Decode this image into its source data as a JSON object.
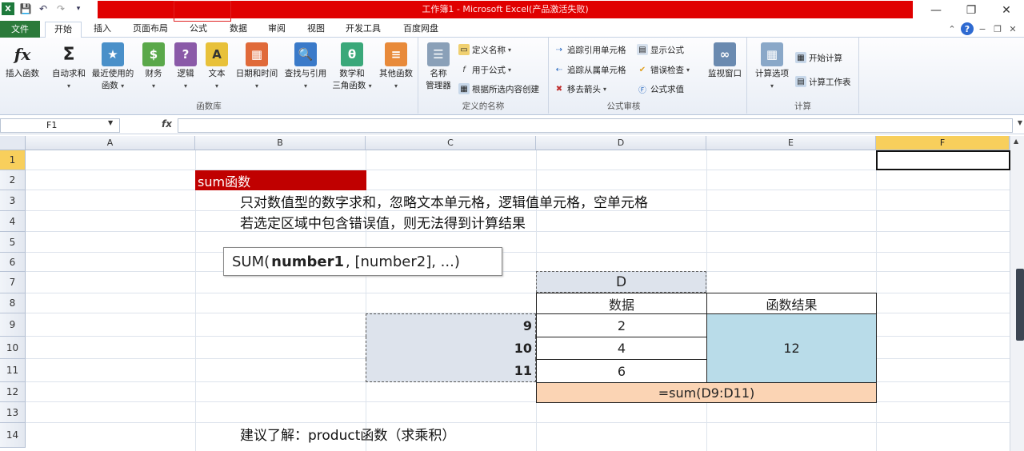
{
  "title_bar": {
    "title": "工作簿1 - Microsoft Excel(产品激活失败)"
  },
  "tabs": [
    {
      "label": "文件",
      "id": "file"
    },
    {
      "label": "开始",
      "id": "home"
    },
    {
      "label": "插入",
      "id": "insert"
    },
    {
      "label": "页面布局",
      "id": "page-layout"
    },
    {
      "label": "公式",
      "id": "formulas"
    },
    {
      "label": "数据",
      "id": "data"
    },
    {
      "label": "审阅",
      "id": "review"
    },
    {
      "label": "视图",
      "id": "view"
    },
    {
      "label": "开发工具",
      "id": "developer"
    },
    {
      "label": "百度网盘",
      "id": "baidu"
    }
  ],
  "ribbon": {
    "function_library": {
      "group_label": "函数库",
      "insert_function": "插入函数",
      "autosum": "自动求和",
      "recent_line1": "最近使用的",
      "recent_line2": "函数",
      "financial": "财务",
      "logical": "逻辑",
      "text": "文本",
      "datetime": "日期和时间",
      "lookup": "查找与引用",
      "math_line1": "数学和",
      "math_line2": "三角函数",
      "more": "其他函数"
    },
    "defined_names": {
      "group_label": "定义的名称",
      "name_manager_line1": "名称",
      "name_manager_line2": "管理器",
      "define_name": "定义名称",
      "use_in_formula": "用于公式",
      "create_from_selection": "根据所选内容创建"
    },
    "formula_auditing": {
      "group_label": "公式审核",
      "trace_precedents": "追踪引用单元格",
      "trace_dependents": "追踪从属单元格",
      "remove_arrows": "移去箭头",
      "show_formulas": "显示公式",
      "error_checking": "错误检查",
      "evaluate_formula": "公式求值",
      "watch_window": "监视窗口"
    },
    "calculation": {
      "group_label": "计算",
      "calc_options": "计算选项",
      "calc_now": "开始计算",
      "calc_sheet": "计算工作表"
    }
  },
  "formula_bar": {
    "name_box": "F1",
    "fx": "fx",
    "formula": ""
  },
  "columns": [
    "A",
    "B",
    "C",
    "D",
    "E",
    "F"
  ],
  "rows": [
    "1",
    "2",
    "3",
    "4",
    "5",
    "6",
    "7",
    "8",
    "9",
    "10",
    "11",
    "12",
    "13",
    "14"
  ],
  "content": {
    "sum_label": "sum函数",
    "desc_line1": "只对数值型的数字求和，忽略文本单元格，逻辑值单元格，空单元格",
    "desc_line2": "若选定区域中包含错误值，则无法得到计算结果",
    "tooltip_prefix": "SUM(",
    "tooltip_bold": "number1",
    "tooltip_suffix": ", [number2], ...)",
    "d7_header": "D",
    "col_data_header": "数据",
    "col_result_header": "函数结果",
    "row_numbers": [
      "9",
      "10",
      "11"
    ],
    "data_values": [
      "2",
      "4",
      "6"
    ],
    "result_value": "12",
    "formula_text": "=sum(D9:D11)",
    "suggestion": "建议了解：product函数（求乘积）"
  },
  "colors": {
    "title_red": "#e00000",
    "file_tab_green": "#2b7a3a",
    "sum_label_red": "#c00000",
    "result_blue": "#b9dce9",
    "formula_peach": "#fbd4b4",
    "selection_gray": "#dde3ec",
    "header_selected": "#f8cf5c"
  }
}
